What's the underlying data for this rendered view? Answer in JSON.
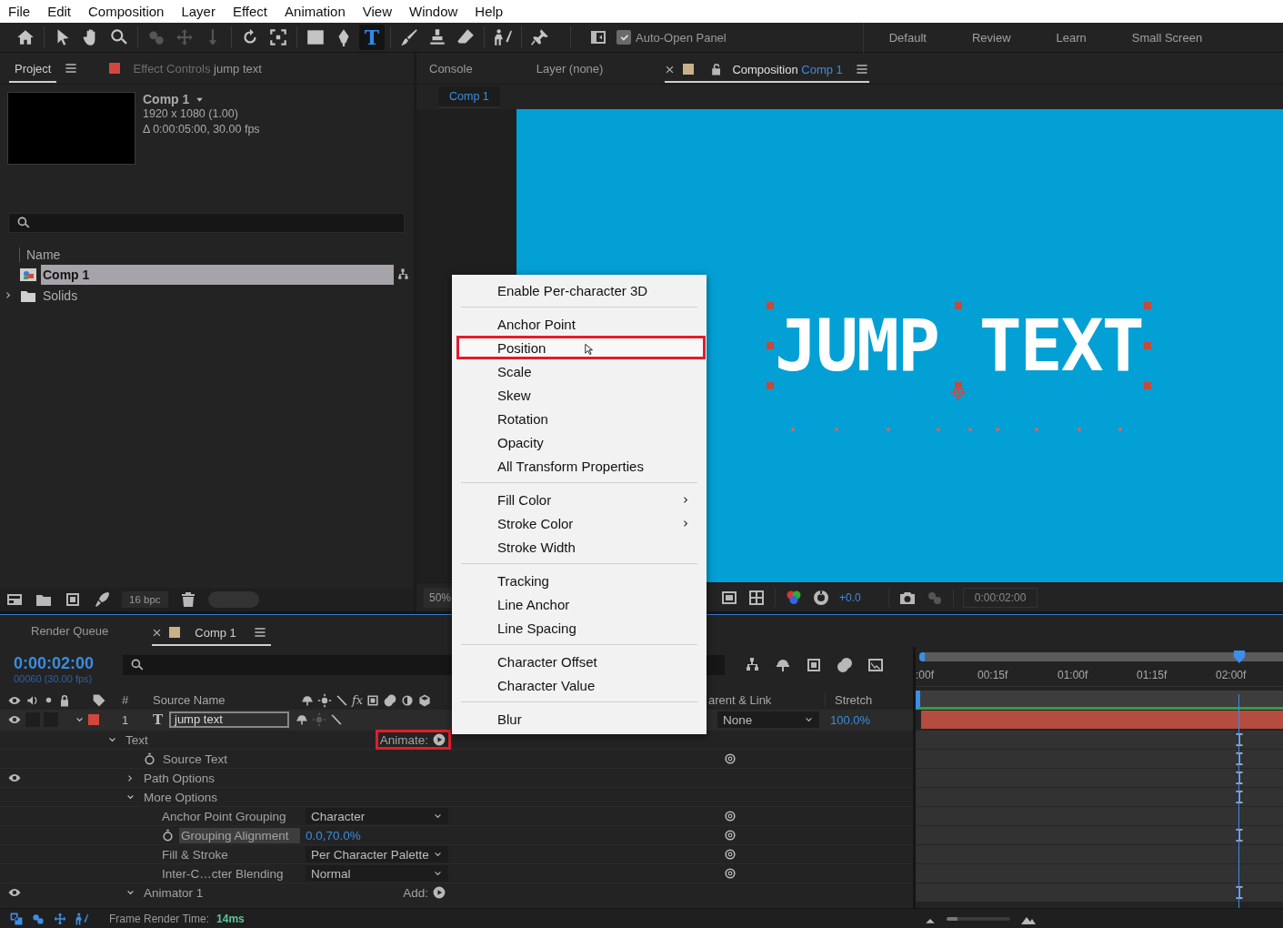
{
  "menu_bar": [
    "File",
    "Edit",
    "Composition",
    "Layer",
    "Effect",
    "Animation",
    "View",
    "Window",
    "Help"
  ],
  "toolbar": {
    "tools": [
      {
        "kind": "home",
        "selected": false,
        "disabled": false
      },
      {
        "kind": "select",
        "selected": false,
        "disabled": false
      },
      {
        "kind": "hand",
        "selected": false,
        "disabled": false
      },
      {
        "kind": "zoom",
        "selected": false,
        "disabled": false
      },
      {
        "kind": "orbit",
        "selected": false,
        "disabled": true
      },
      {
        "kind": "pan",
        "selected": false,
        "disabled": true
      },
      {
        "kind": "dolly",
        "selected": false,
        "disabled": true
      },
      {
        "kind": "rotate",
        "selected": false,
        "disabled": false
      },
      {
        "kind": "region",
        "selected": false,
        "disabled": false
      },
      {
        "kind": "rectangle",
        "selected": false,
        "disabled": false
      },
      {
        "kind": "pen",
        "selected": false,
        "disabled": false
      },
      {
        "kind": "text",
        "glyph": "T",
        "selected": true,
        "disabled": false
      },
      {
        "kind": "brush",
        "selected": false,
        "disabled": false
      },
      {
        "kind": "stamp",
        "selected": false,
        "disabled": false
      },
      {
        "kind": "eraser",
        "selected": false,
        "disabled": false
      },
      {
        "kind": "puppet",
        "selected": false,
        "disabled": false
      },
      {
        "kind": "pin",
        "selected": false,
        "disabled": false
      }
    ],
    "auto_open_panel": {
      "label": "Auto-Open Panel",
      "checked": true
    },
    "workspaces": [
      "Default",
      "Review",
      "Learn",
      "Small Screen"
    ]
  },
  "project_panel": {
    "tabs": [
      {
        "label": "Project",
        "selected": true
      },
      {
        "label": "Effect Controls",
        "target": "jump text",
        "selected": false
      }
    ],
    "preview": {
      "name": "Comp 1",
      "info": [
        "1920 x 1080 (1.00)",
        "Δ 0:00:05:00, 30.00 fps"
      ]
    },
    "name_column": "Name",
    "items": [
      {
        "kind": "comp",
        "name": "Comp 1",
        "selected": true
      },
      {
        "kind": "folder",
        "name": "Solids",
        "selected": false,
        "expanded": false
      }
    ],
    "bit_depth": "16 bpc"
  },
  "viewer": {
    "tabs": [
      {
        "label": "Console",
        "selected": false
      },
      {
        "label": "Layer (none)",
        "selected": false
      },
      {
        "label": "Composition",
        "target": "Comp 1",
        "selected": true
      }
    ],
    "breadcrumb": "Comp 1",
    "comp_text": "JUMP TEXT",
    "zoom": "50%",
    "exposure": "+0.0",
    "time": "0:00:02:00"
  },
  "context_menu": {
    "items": [
      {
        "kind": "item",
        "label": "Enable Per-character 3D",
        "selected": false
      },
      {
        "kind": "separator"
      },
      {
        "kind": "item",
        "label": "Anchor Point",
        "selected": false
      },
      {
        "kind": "item",
        "label": "Position",
        "selected": true
      },
      {
        "kind": "item",
        "label": "Scale",
        "selected": false
      },
      {
        "kind": "item",
        "label": "Skew",
        "selected": false
      },
      {
        "kind": "item",
        "label": "Rotation",
        "selected": false
      },
      {
        "kind": "item",
        "label": "Opacity",
        "selected": false
      },
      {
        "kind": "item",
        "label": "All Transform Properties",
        "selected": false
      },
      {
        "kind": "separator"
      },
      {
        "kind": "submenu",
        "label": "Fill Color",
        "selected": false
      },
      {
        "kind": "submenu",
        "label": "Stroke Color",
        "selected": false
      },
      {
        "kind": "item",
        "label": "Stroke Width",
        "selected": false
      },
      {
        "kind": "separator"
      },
      {
        "kind": "item",
        "label": "Tracking",
        "selected": false
      },
      {
        "kind": "item",
        "label": "Line Anchor",
        "selected": false
      },
      {
        "kind": "item",
        "label": "Line Spacing",
        "selected": false
      },
      {
        "kind": "separator"
      },
      {
        "kind": "item",
        "label": "Character Offset",
        "selected": false
      },
      {
        "kind": "item",
        "label": "Character Value",
        "selected": false
      },
      {
        "kind": "separator"
      },
      {
        "kind": "item",
        "label": "Blur",
        "selected": false
      }
    ]
  },
  "timeline": {
    "tabs": [
      {
        "label": "Render Queue",
        "selected": false
      },
      {
        "label": "Comp 1",
        "selected": true
      }
    ],
    "current_time": "0:00:02:00",
    "frame_info": "00060 (30.00 fps)",
    "headers": {
      "number": "#",
      "source_name": "Source Name",
      "effects": "fx",
      "parent": "arent & Link",
      "stretch": "Stretch"
    },
    "layer": {
      "number": "1",
      "type_glyph": "T",
      "name": "jump text",
      "parent": "None",
      "stretch": "100.0%",
      "visible": true,
      "expanded": true
    },
    "properties": [
      {
        "kind": "group",
        "name": "Text",
        "expanded": true,
        "eye": false,
        "stopwatch": false,
        "link": false,
        "keyframe": true,
        "selected": false,
        "action": "Animate:",
        "highlighted": true,
        "children": [
          {
            "kind": "property",
            "name": "Source Text",
            "eye": false,
            "stopwatch": true,
            "link": true,
            "keyframe": true,
            "selected": false
          },
          {
            "kind": "group",
            "name": "Path Options",
            "expanded": false,
            "eye": true,
            "stopwatch": false,
            "link": false,
            "keyframe": true,
            "selected": false
          },
          {
            "kind": "group",
            "name": "More Options",
            "expanded": true,
            "eye": false,
            "stopwatch": false,
            "link": false,
            "keyframe": true,
            "selected": false,
            "children": [
              {
                "kind": "dropdown",
                "name": "Anchor Point Grouping",
                "value": "Character",
                "eye": false,
                "stopwatch": false,
                "link": true,
                "keyframe": false,
                "selected": false
              },
              {
                "kind": "number",
                "name": "Grouping Alignment",
                "value": "0.0,70.0%",
                "eye": false,
                "stopwatch": true,
                "link": true,
                "keyframe": true,
                "selected": true
              },
              {
                "kind": "dropdown",
                "name": "Fill & Stroke",
                "value": "Per Character Palette",
                "eye": false,
                "stopwatch": false,
                "link": true,
                "keyframe": false,
                "selected": false
              },
              {
                "kind": "dropdown",
                "name": "Inter-C…cter Blending",
                "value": "Normal",
                "eye": false,
                "stopwatch": false,
                "link": true,
                "keyframe": false,
                "selected": false
              }
            ]
          },
          {
            "kind": "group",
            "name": "Animator 1",
            "expanded": true,
            "eye": true,
            "stopwatch": false,
            "link": false,
            "keyframe": true,
            "selected": false,
            "action": "Add:",
            "highlighted": false
          }
        ]
      }
    ],
    "ruler": [
      ":00f",
      "00:15f",
      "01:00f",
      "01:15f",
      "02:00f"
    ],
    "render_time": {
      "label": "Frame Render Time:",
      "value": "14ms"
    }
  }
}
